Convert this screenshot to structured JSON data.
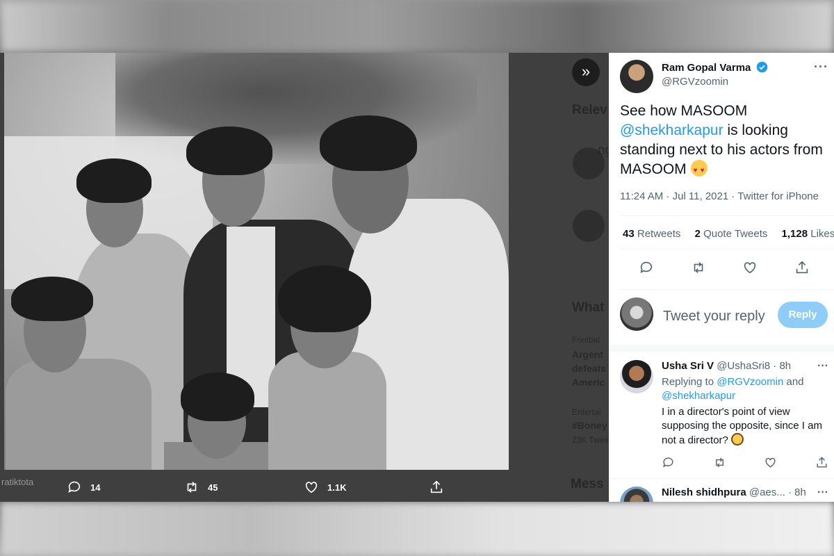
{
  "viewer": {
    "expand_label": "»",
    "ghost": {
      "relevant_heading": "Relev",
      "ing_fragment": "ng",
      "whats_heading": "What",
      "football_label": "Footbal",
      "trend1_line1": "Argent",
      "trend1_line2": "defeats",
      "trend1_line3": "Americ",
      "entertainment_label": "Entertai",
      "trend2": "#Boney",
      "trend2_count": "23K Twee",
      "messages_heading": "Mess"
    },
    "side_cut_text": "ratiktota",
    "actions": {
      "replies": "14",
      "retweets": "45",
      "likes": "1.1K"
    }
  },
  "tweet": {
    "author_name": "Ram Gopal Varma",
    "author_handle": "@RGVzoomin",
    "more_label": "···",
    "text_before": "See how MASOOM ",
    "text_mention": "@shekharkapur",
    "text_after": " is looking standing next to his actors from MASOOM ",
    "timestamp": "11:24 AM · Jul 11, 2021 · Twitter for iPhone",
    "stats": {
      "retweets_count": "43",
      "retweets_label": "Retweets",
      "quotes_count": "2",
      "quotes_label": "Quote Tweets",
      "likes_count": "1,128",
      "likes_label": "Likes"
    },
    "reply_placeholder": "Tweet your reply",
    "reply_button": "Reply"
  },
  "replies": [
    {
      "name": "Usha Sri V",
      "handle_time": "@UshaSri8 · 8h",
      "replying_prefix": "Replying to ",
      "replying_mention1": "@RGVzoomin",
      "replying_and": " and ",
      "replying_mention2": "@shekharkapur",
      "body": "I in a director's point of view supposing the opposite, since I am not a director? ",
      "more": "···"
    },
    {
      "name": "Nilesh shidhpura",
      "handle_time": "@aes... · 8h",
      "more": "···"
    }
  ],
  "colors": {
    "accent": "#1d9bf0",
    "reply_button_bg": "#8ecdf8",
    "viewer_bg": "#3f3f3f"
  },
  "icons": [
    "expand-icon",
    "reply-icon",
    "retweet-icon",
    "like-icon",
    "share-icon",
    "verified-icon"
  ]
}
